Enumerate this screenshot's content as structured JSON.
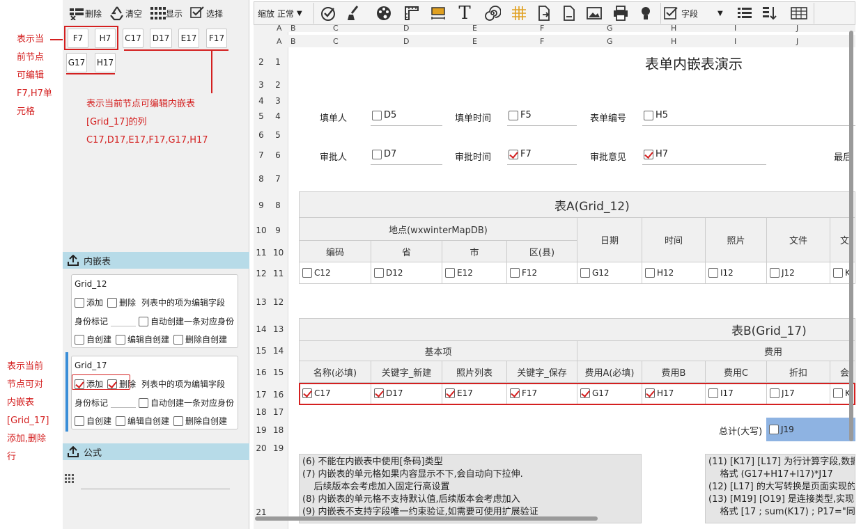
{
  "annotations": {
    "top_left": [
      "表示当",
      "前节点",
      "可编辑",
      "F7,H7单",
      "元格"
    ],
    "middle": [
      "表示当前节点可编辑内嵌表",
      "[Grid_17]的列",
      "C17,D17,E17,F17,G17,H17"
    ],
    "bottom_left": [
      "表示当前",
      "节点可对",
      "内嵌表",
      "[Grid_17]",
      "添加,删除",
      "行"
    ]
  },
  "left_toolbar": {
    "delete": "删除",
    "clear": "清空",
    "show": "显示",
    "select": "选择"
  },
  "editable_cells": [
    "F7",
    "H7"
  ],
  "editable_columns": [
    "C17",
    "D17",
    "E17",
    "F17",
    "G17",
    "H17"
  ],
  "embedded_section": {
    "title": "内嵌表",
    "grids": [
      {
        "name": "Grid_12",
        "add": "添加",
        "delete": "删除",
        "desc": "列表中的项为编辑字段",
        "identity": "身份标记",
        "auto": "自动创建一条对应身份",
        "self_create": "自创建",
        "edit_self": "编辑自创建",
        "del_self": "删除自创建",
        "add_on": false,
        "delete_on": false
      },
      {
        "name": "Grid_17",
        "add": "添加",
        "delete": "删除",
        "desc": "列表中的项为编辑字段",
        "identity": "身份标记",
        "auto": "自动创建一条对应身份",
        "self_create": "自创建",
        "edit_self": "编辑自创建",
        "del_self": "删除自创建",
        "add_on": true,
        "delete_on": true
      }
    ]
  },
  "formula_section": {
    "title": "公式"
  },
  "main_toolbar": {
    "zoom_label": "缩放",
    "zoom_value": "正常",
    "field_label": "字段"
  },
  "col_headers": [
    "A",
    "B",
    "C",
    "D",
    "E",
    "F",
    "G",
    "H",
    "I",
    "J"
  ],
  "row_numbers": [
    [
      "1",
      "A"
    ],
    [
      "2",
      "1"
    ],
    [
      "3",
      "2"
    ],
    [
      "4",
      "3"
    ],
    [
      "5",
      "4"
    ],
    [
      "6",
      "5"
    ],
    [
      "7",
      "6"
    ],
    [
      "8",
      "7"
    ],
    [
      "9",
      "8"
    ],
    [
      "10",
      "9"
    ],
    [
      "11",
      "10"
    ],
    [
      "12",
      "11"
    ],
    [
      "13",
      "12"
    ],
    [
      "14",
      "13"
    ],
    [
      "15",
      "14"
    ],
    [
      "16",
      "15"
    ],
    [
      "17",
      "16"
    ],
    [
      "18",
      "17"
    ],
    [
      "19",
      "18"
    ],
    [
      "20",
      "19"
    ],
    [
      "21",
      ""
    ]
  ],
  "form": {
    "title": "表单内嵌表演示",
    "filler_label": "填单人",
    "filler_cell": "D5",
    "fill_time_label": "填单时间",
    "fill_time_cell": "F5",
    "form_no_label": "表单编号",
    "form_no_cell": "H5",
    "approver_label": "审批人",
    "approver_cell": "D7",
    "approve_time_label": "审批时间",
    "approve_time_cell": "F7",
    "approve_opinion_label": "审批意见",
    "approve_opinion_cell": "H7",
    "last_label": "最后"
  },
  "gridA": {
    "title": "表A(Grid_12)",
    "group": "地点(wxwinterMapDB)",
    "headers": [
      "编码",
      "省",
      "市",
      "区(县)",
      "日期",
      "时间",
      "照片",
      "文件",
      "文"
    ],
    "cells": [
      "C12",
      "D12",
      "E12",
      "F12",
      "G12",
      "H12",
      "I12",
      "J12",
      "K"
    ]
  },
  "gridB": {
    "title": "表B(Grid_17)",
    "group_basic": "基本项",
    "group_fee": "费用",
    "headers": [
      "名称(必填)",
      "关键字_新建",
      "照片列表",
      "关键字_保存",
      "费用A(必填)",
      "费用B",
      "费用C",
      "折扣",
      "会"
    ],
    "cells": [
      "C17",
      "D17",
      "E17",
      "F17",
      "G17",
      "H17",
      "I17",
      "J17",
      "K"
    ],
    "total_label": "总计(大写)",
    "total_cell": "J19"
  },
  "notes_left": [
    "(6) 不能在内嵌表中使用[条码]类型",
    "(7) 内嵌表的单元格如果内容显示不下,会自动向下拉伸.",
    "    后续版本会考虑加入固定行高设置",
    "(8) 内嵌表的单元格不支持默认值,后续版本会考虑加入",
    "(9) 内嵌表不支持字段唯一约束验证,如需要可使用扩展验证"
  ],
  "notes_right": [
    "(11) [K17] [L17] 为行计算字段,数据",
    "    格式 (G17+H17+I17)*J17",
    "(12) [L17] 的大写转换是页面实现的",
    "(13) [M19] [O19] 是连接类型,实现",
    "    格式 [17 ; sum(K17) ; P17=\"同"
  ]
}
